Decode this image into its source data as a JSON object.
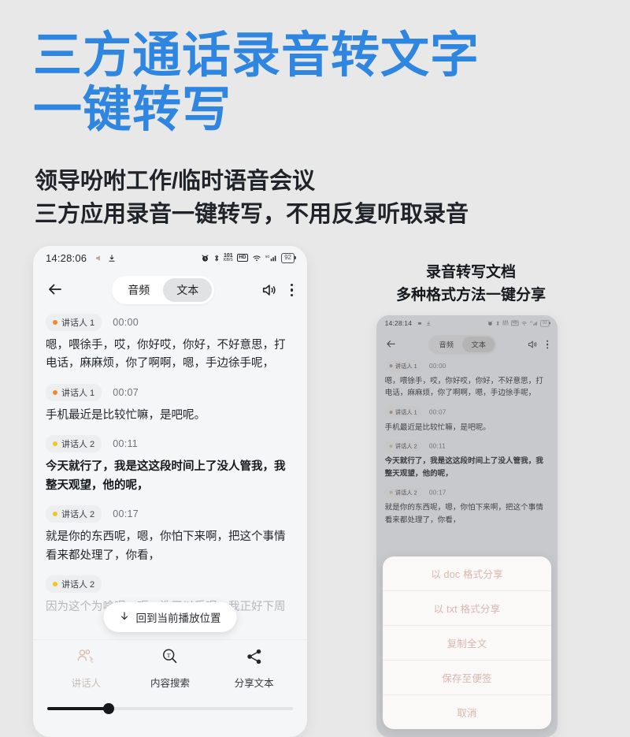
{
  "promo": {
    "title": "三方通话录音转文字\n一键转写",
    "subtitle": "领导吩咐工作/临时语音会议\n三方应用录音一键转写，不用反复听取录音",
    "accent_color": "#2f86e0",
    "right_caption": "录音转写文档\n多种格式方法一键分享"
  },
  "phone_main": {
    "status": {
      "time": "14:28:06",
      "net_speed_value": "101",
      "net_speed_unit": "KB/S",
      "hd_label": "HD",
      "signal_label": "5G",
      "battery": "92"
    },
    "header": {
      "back_icon": "back-arrow-icon",
      "tabs": [
        {
          "label": "音频",
          "active": false
        },
        {
          "label": "文本",
          "active": true
        }
      ],
      "volume_icon": "speaker-icon",
      "more_icon": "more-vertical-icon"
    },
    "speaker_colors": {
      "speaker1": "#f08a2c",
      "speaker2": "#f3c623"
    },
    "segments": [
      {
        "speaker": "讲话人 1",
        "speaker_key": "speaker1",
        "time": "00:00",
        "text": "嗯，喂徐手，哎，你好哎，你好，不好意思，打电话，麻麻烦，你了啊啊，嗯，手边徐手呢，",
        "style": "normal"
      },
      {
        "speaker": "讲话人 1",
        "speaker_key": "speaker1",
        "time": "00:07",
        "text": "手机最近是比较忙嘛，是吧呢。",
        "style": "normal"
      },
      {
        "speaker": "讲话人 2",
        "speaker_key": "speaker2",
        "time": "00:11",
        "text": "今天就行了，我是这这段时间上了没人管我，我整天观望，他的呢，",
        "style": "bold"
      },
      {
        "speaker": "讲话人 2",
        "speaker_key": "speaker2",
        "time": "00:17",
        "text": "就是你的东西呢，嗯，你怕下来啊，把这个事情看来都处理了，你看，",
        "style": "normal"
      },
      {
        "speaker": "讲话人 2",
        "speaker_key": "speaker2",
        "time": "",
        "text": "因为这个为啥呢，呃，洗了以后呢，我正好下周",
        "style": "faded"
      }
    ],
    "back_to_play_label": "回到当前播放位置",
    "back_to_play_icon": "arrow-down-icon",
    "toolbar": [
      {
        "label": "讲话人",
        "icon": "speakers-icon",
        "dim": true
      },
      {
        "label": "内容搜索",
        "icon": "text-search-icon",
        "dim": false
      },
      {
        "label": "分享文本",
        "icon": "share-icon",
        "dim": false
      }
    ],
    "player": {
      "progress_percent": 25
    }
  },
  "phone_secondary": {
    "status": {
      "time": "14:28:14",
      "net_speed_value": "101",
      "net_speed_unit": "KB/S",
      "hd_label": "HD",
      "signal_label": "5G",
      "battery": "92"
    },
    "header": {
      "tabs": [
        {
          "label": "音频",
          "active": false
        },
        {
          "label": "文本",
          "active": true
        }
      ]
    },
    "action_sheet": [
      {
        "label": "以 doc 格式分享"
      },
      {
        "label": "以 txt 格式分享"
      },
      {
        "label": "复制全文"
      },
      {
        "label": "保存至便签"
      },
      {
        "label": "取消"
      }
    ]
  }
}
